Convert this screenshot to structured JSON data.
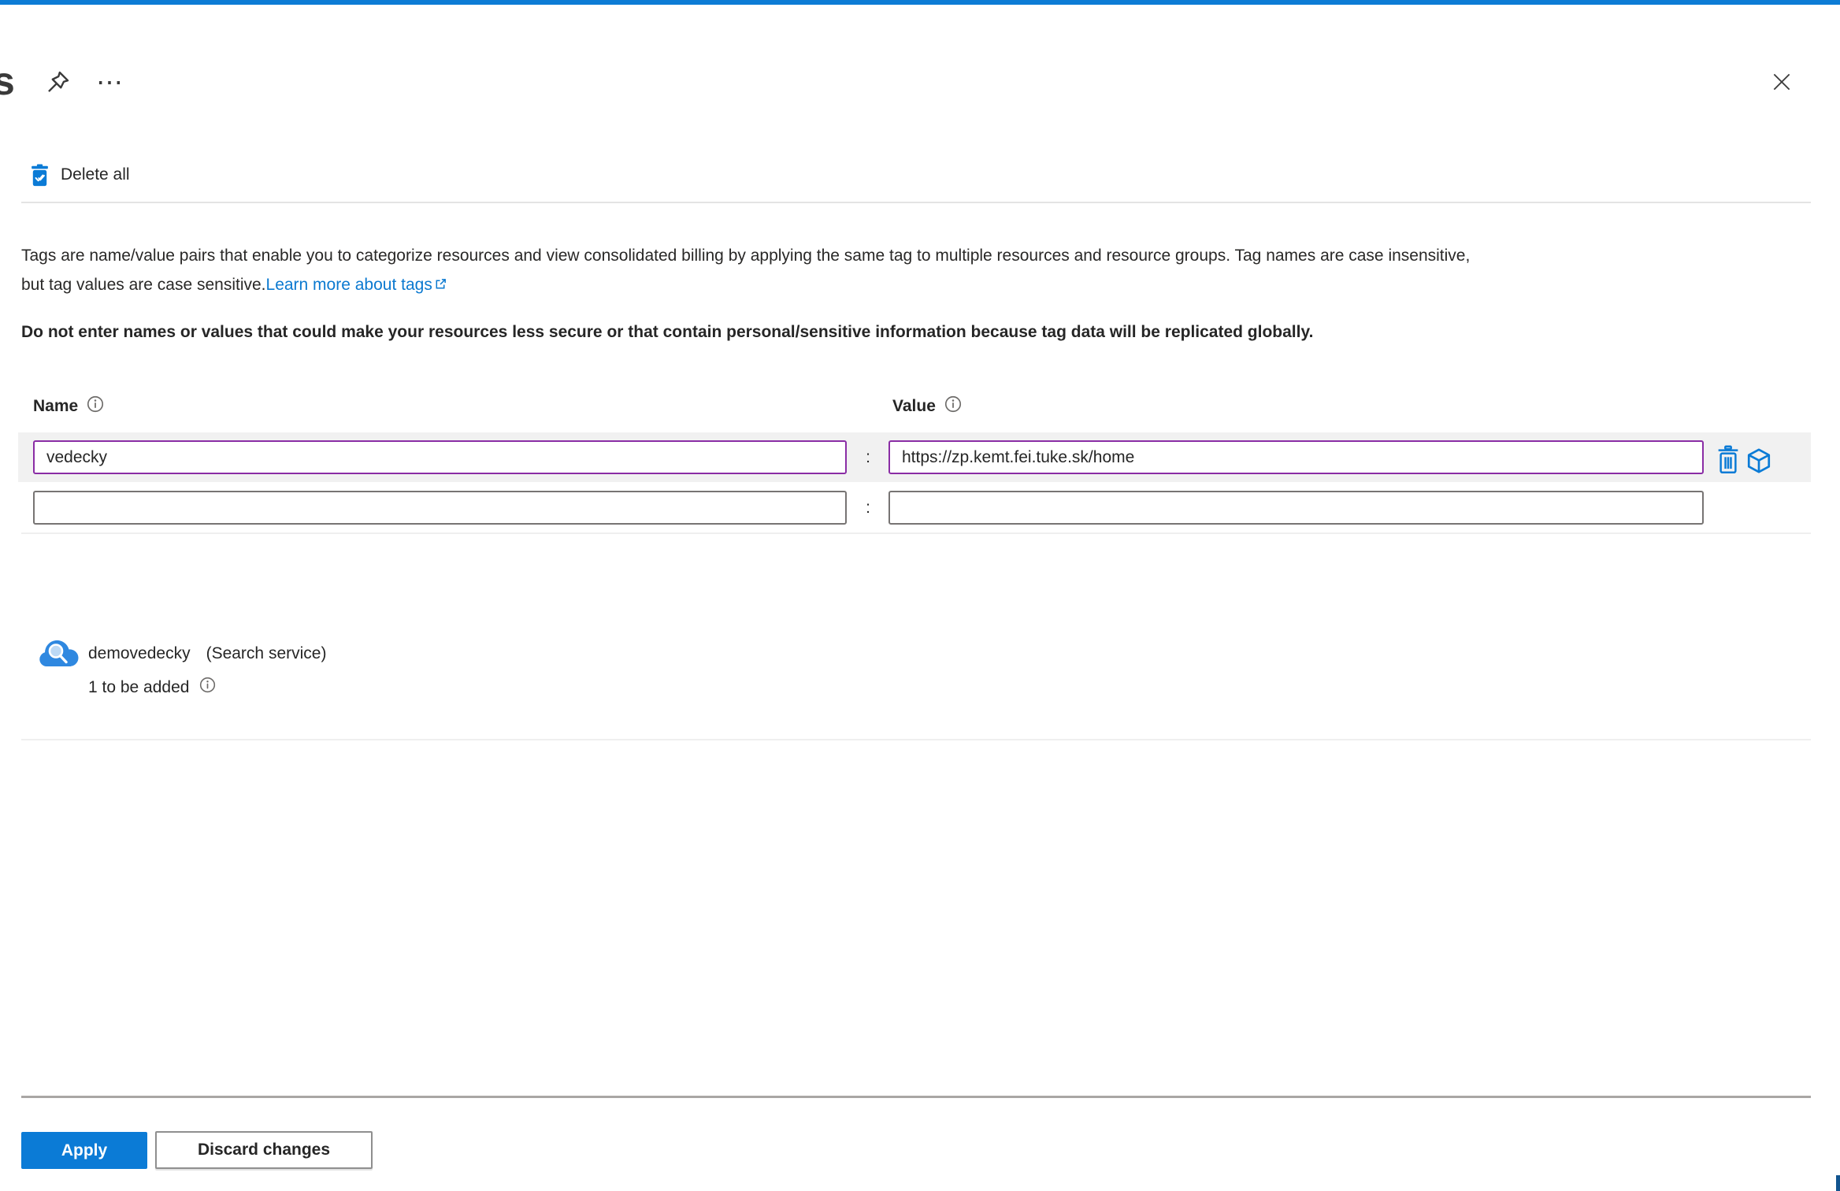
{
  "header": {
    "title_fragment": "s",
    "more_glyph": "⋯"
  },
  "toolbar": {
    "delete_all_label": "Delete all"
  },
  "intro": {
    "line1": "Tags are name/value pairs that enable you to categorize resources and view consolidated billing by applying the same tag to multiple resources and resource groups. Tag names are case insensitive,",
    "line2": "but tag values are case sensitive.",
    "link_label": "Learn more about tags",
    "warning": "Do not enter names or values that could make your resources less secure or that contain personal/sensitive information because tag data will be replicated globally."
  },
  "tag_editor": {
    "name_header": "Name",
    "value_header": "Value",
    "separator": ":",
    "rows": [
      {
        "name": "vedecky",
        "value": "https://zp.kemt.fei.tuke.sk/home"
      },
      {
        "name": "",
        "value": ""
      }
    ]
  },
  "resource": {
    "name": "demovedecky",
    "type": "(Search service)",
    "status": "1 to be added"
  },
  "footer": {
    "apply_label": "Apply",
    "discard_label": "Discard changes"
  },
  "colors": {
    "accent": "#0078d4",
    "modified_border": "#8a2da5",
    "link": "#0078d4",
    "row_background": "#f1f1f1"
  }
}
